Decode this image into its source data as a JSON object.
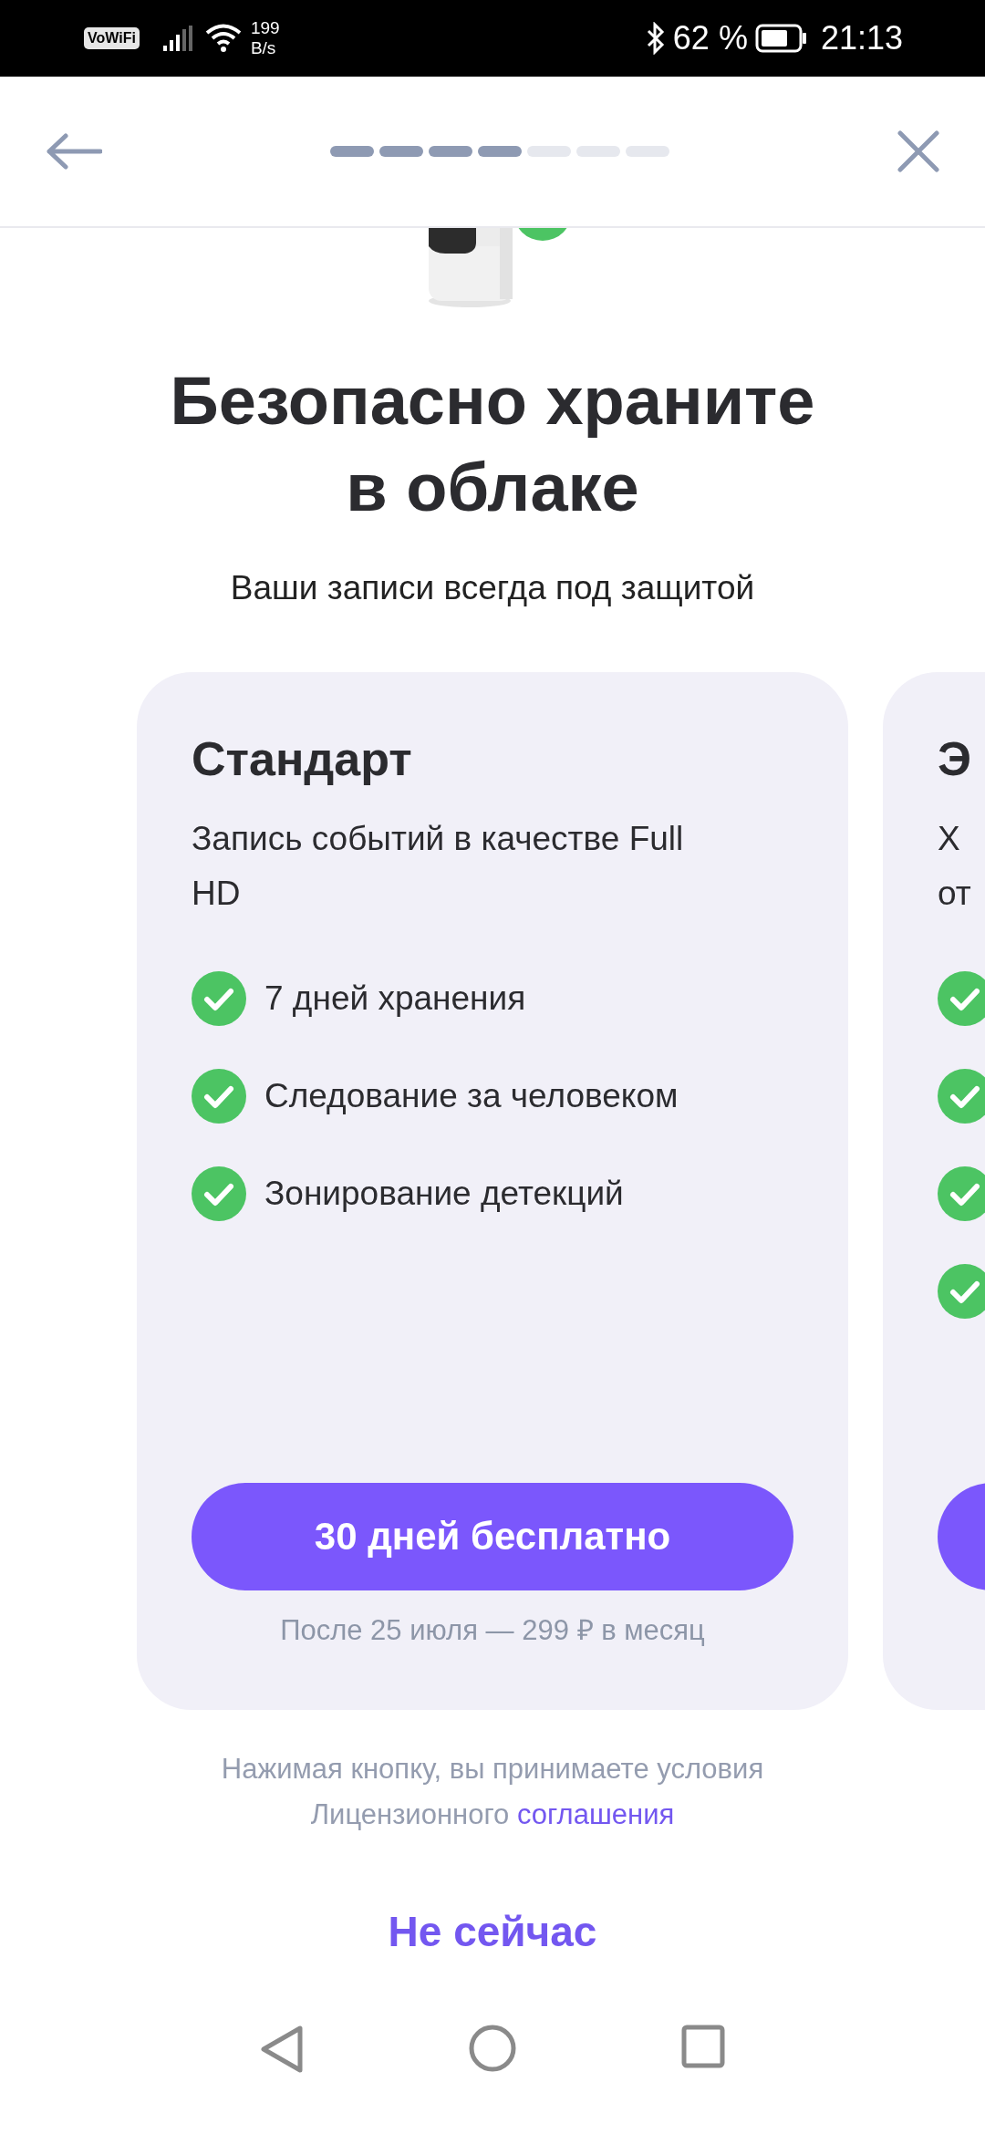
{
  "status_bar": {
    "vowifi": "VoWiFi",
    "speed_value": "199",
    "speed_unit": "B/s",
    "battery": "62 %",
    "time": "21:13"
  },
  "header": {
    "steps": [
      {
        "done": true
      },
      {
        "done": true
      },
      {
        "done": true
      },
      {
        "done": true
      },
      {
        "done": false
      },
      {
        "done": false
      },
      {
        "done": false
      }
    ]
  },
  "title": "Безопасно храните в облаке",
  "subtitle": "Ваши записи всегда под защитой",
  "plans": [
    {
      "title": "Стандарт",
      "description": "Запись событий в качестве Full HD",
      "features": [
        {
          "kind": "check",
          "label": "7 дней хранения"
        },
        {
          "kind": "check",
          "label": "Следование за человеком"
        },
        {
          "kind": "check",
          "label": "Зонирование детекций"
        }
      ],
      "button": "30 дней бесплатно",
      "price_note": "После 25 июля — 299 ₽ в месяц"
    },
    {
      "title": "Э",
      "description": "Х\nот",
      "features": [
        {
          "kind": "check"
        },
        {
          "kind": "check"
        },
        {
          "kind": "check"
        },
        {
          "kind": "check"
        }
      ]
    }
  ],
  "terms": {
    "text": "Нажимая кнопку, вы принимаете условия Лицензионного",
    "link": "соглашения"
  },
  "secondary_button": "Не сейчас"
}
